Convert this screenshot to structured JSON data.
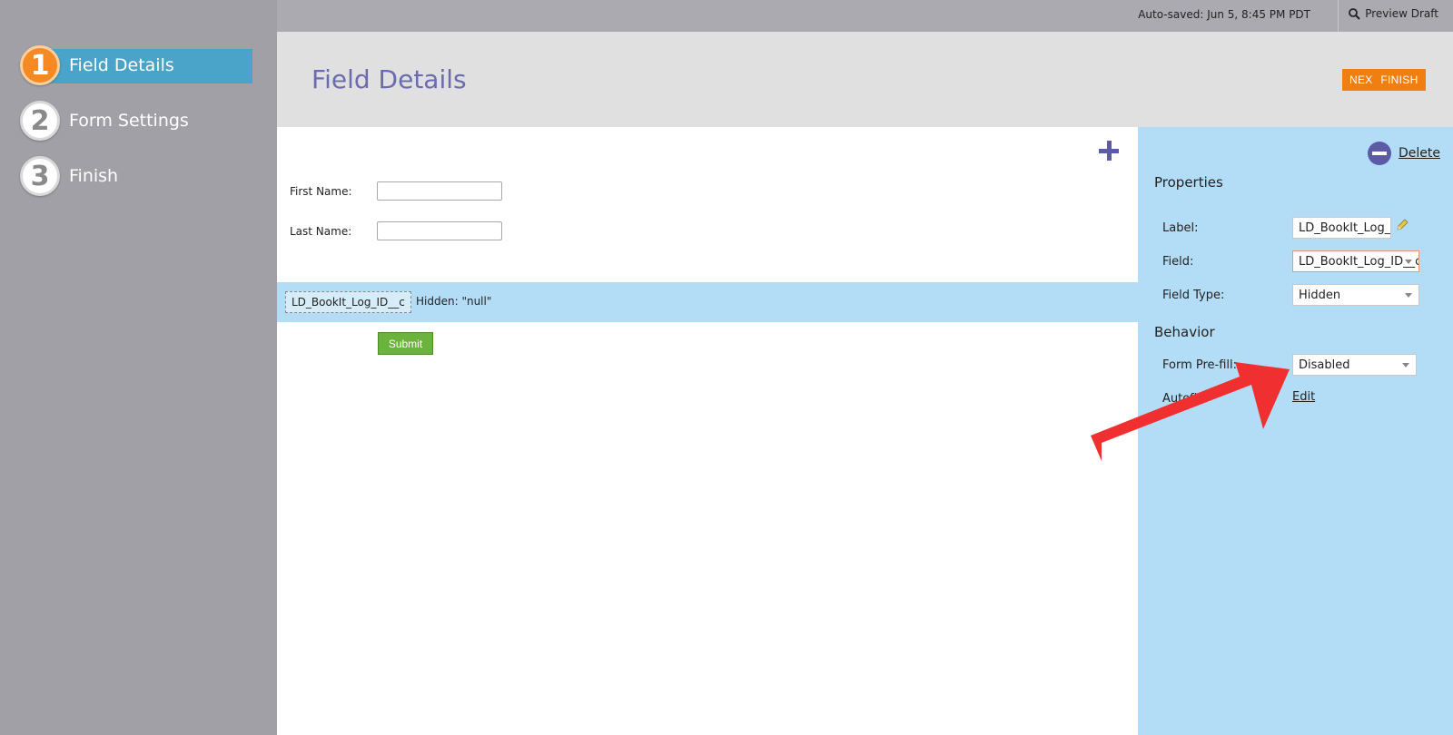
{
  "steps": [
    {
      "number": "1",
      "label": "Field Details",
      "active": true
    },
    {
      "number": "2",
      "label": "Form Settings",
      "active": false
    },
    {
      "number": "3",
      "label": "Finish",
      "active": false
    }
  ],
  "topbar": {
    "autosaved": "Auto-saved: Jun 5, 8:45 PM PDT",
    "preview_label": "Preview Draft",
    "preview_icon": "search-icon"
  },
  "header": {
    "title": "Field Details",
    "next_label": "NEXT",
    "finish_label": "FINISH"
  },
  "form": {
    "fields": [
      {
        "label": "First Name:",
        "value": ""
      },
      {
        "label": "Last Name:",
        "value": ""
      }
    ],
    "hidden_field": {
      "name": "LD_BookIt_Log_ID__c",
      "note": "Hidden: \"null\""
    },
    "submit_label": "Submit"
  },
  "properties": {
    "delete_label": "Delete",
    "section_properties": "Properties",
    "label_label": "Label:",
    "label_value": "LD_BookIt_Log_ID__c",
    "field_label": "Field:",
    "field_value": "LD_BookIt_Log_ID__c",
    "field_type_label": "Field Type:",
    "field_type_value": "Hidden",
    "section_behavior": "Behavior",
    "prefill_label": "Form Pre-fill:",
    "prefill_value": "Disabled",
    "autofill_label": "Autofill:",
    "edit_label": "Edit"
  },
  "colors": {
    "accent_orange": "#f07f12",
    "step_active": "#4aa3c8",
    "panel_blue": "#b3ddf6",
    "title_purple": "#6b6bb0",
    "annotation_red": "#f03030"
  }
}
